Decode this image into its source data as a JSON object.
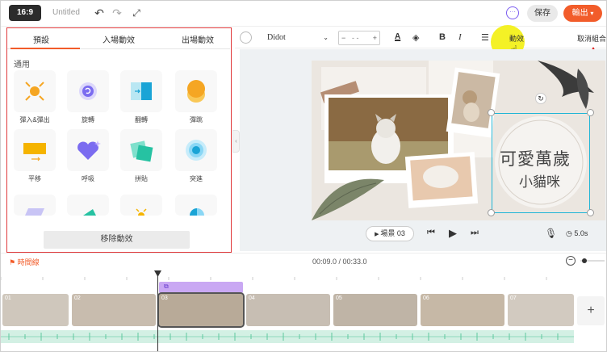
{
  "topbar": {
    "ratio": "16:9",
    "doc_title": "Untitled",
    "save_label": "保存",
    "export_label": "輸出"
  },
  "panel": {
    "tabs": [
      "預設",
      "入場動效",
      "出場動效"
    ],
    "section_label": "通用",
    "animations": [
      "彈入&彈出",
      "旋轉",
      "翻轉",
      "彈跳",
      "平移",
      "呼吸",
      "拼貼",
      "突進"
    ],
    "remove_label": "移除動效"
  },
  "text_toolbar": {
    "font": "Didot",
    "size_value": "- -",
    "effects_label": "動效",
    "ungroup_label": "取消組合"
  },
  "canvas": {
    "title_text": "可愛萬歲",
    "subtitle_text": "小貓咪"
  },
  "player": {
    "scene_label": "場景 03",
    "duration": "5.0s"
  },
  "timeline": {
    "label": "時間線",
    "time": "00:09.0 / 00:33.0",
    "scenes": [
      "01",
      "02",
      "03",
      "04",
      "05",
      "06",
      "07"
    ]
  },
  "colors": {
    "accent": "#f25c2a",
    "panel_border": "#e0393b",
    "overlay": "#c9a8f3",
    "audio": "#d3f0e4",
    "selection": "#1fb5d6"
  }
}
